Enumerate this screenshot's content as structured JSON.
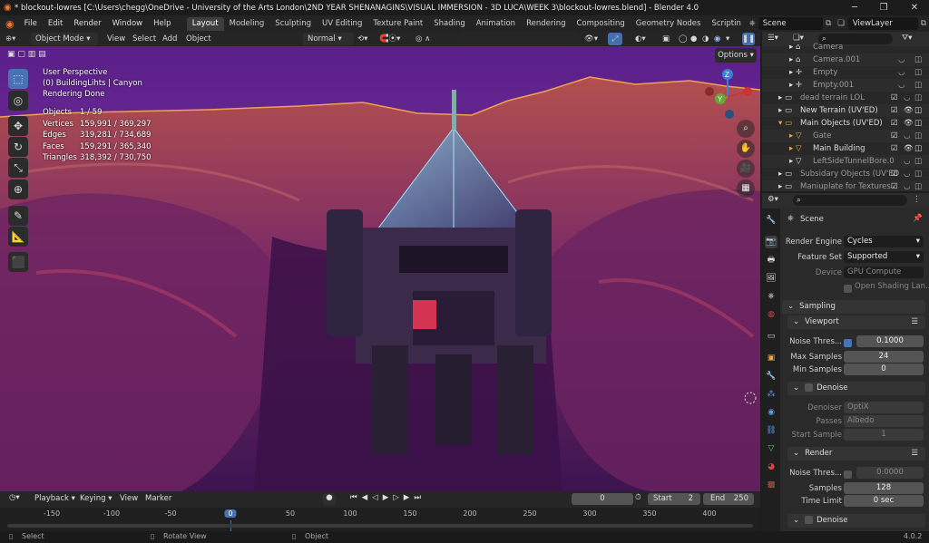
{
  "window": {
    "title": "* blockout-lowres [C:\\Users\\chegg\\OneDrive - University of the Arts London\\2ND YEAR SHENANAGINS\\VISUAL IMMERSION - 3D LUCA\\WEEK 3\\blockout-lowres.blend] - Blender 4.0",
    "minimize": "─",
    "maximize": "❐",
    "close": "✕"
  },
  "menu": [
    "File",
    "Edit",
    "Render",
    "Window",
    "Help"
  ],
  "workspaces": [
    "Layout",
    "Modeling",
    "Sculpting",
    "UV Editing",
    "Texture Paint",
    "Shading",
    "Animation",
    "Rendering",
    "Compositing",
    "Geometry Nodes",
    "Scriptin"
  ],
  "scene": {
    "label": "Scene",
    "viewlayer": "ViewLayer"
  },
  "viewport_header": {
    "mode": "Object Mode",
    "menus": [
      "View",
      "Select",
      "Add",
      "Object"
    ],
    "orientation": "Normal",
    "options": "Options"
  },
  "overlay": {
    "perspective": "User Perspective",
    "collection": "(0) BuildingLihts | Canyon",
    "status": "Rendering Done",
    "stats": [
      {
        "label": "Objects",
        "value": "1 / 59"
      },
      {
        "label": "Vertices",
        "value": "159,991 / 369,297"
      },
      {
        "label": "Edges",
        "value": "319,281 / 734,689"
      },
      {
        "label": "Faces",
        "value": "159,291 / 365,340"
      },
      {
        "label": "Triangles",
        "value": "318,392 / 730,750"
      }
    ]
  },
  "gizmo": {
    "z": "Z",
    "y": "Y"
  },
  "timeline": {
    "menus": [
      "Playback",
      "Keying",
      "View",
      "Marker"
    ],
    "current_frame": "0",
    "start_label": "Start",
    "start": "2",
    "end_label": "End",
    "end": "250",
    "ruler": [
      "-150",
      "-100",
      "-50",
      "0",
      "50",
      "100",
      "150",
      "200",
      "250",
      "300",
      "350",
      "400"
    ]
  },
  "statusbar": {
    "select": "Select",
    "rotate": "Rotate View",
    "object": "Object",
    "version": "4.0.2"
  },
  "outliner": {
    "rows": [
      {
        "label": "Camera",
        "dim": true
      },
      {
        "label": "Camera.001",
        "dim": true
      },
      {
        "label": "Empty",
        "dim": true
      },
      {
        "label": "Empty.001",
        "dim": true
      },
      {
        "label": "dead terrain LOL",
        "dim": true
      },
      {
        "label": "New Terrain (UV'ED)",
        "dim": false
      },
      {
        "label": "Main Objects (UV'ED)",
        "dim": false
      },
      {
        "label": "Gate",
        "dim": true
      },
      {
        "label": "Main Building",
        "dim": false
      },
      {
        "label": "LeftSideTunnelBore.0",
        "dim": true
      },
      {
        "label": "Subsidary Objects (UV'ED",
        "dim": true
      },
      {
        "label": "Maniuplate for Textures",
        "dim": true
      }
    ]
  },
  "properties": {
    "title": "Scene",
    "render_engine_label": "Render Engine",
    "render_engine": "Cycles",
    "feature_set_label": "Feature Set",
    "feature_set": "Supported",
    "device_label": "Device",
    "device": "GPU Compute",
    "open_shading": "Open Shading Lan...",
    "sampling": "Sampling",
    "viewport": "Viewport",
    "noise_threshold_label": "Noise Thres...",
    "viewport_noise": "0.1000",
    "max_samples_label": "Max Samples",
    "max_samples": "24",
    "min_samples_label": "Min Samples",
    "min_samples": "0",
    "denoise": "Denoise",
    "denoiser_label": "Denoiser",
    "denoiser": "OptiX",
    "passes_label": "Passes",
    "passes": "Albedo",
    "start_sample_label": "Start Sample",
    "start_sample": "1",
    "render": "Render",
    "render_noise": "0.0000",
    "samples_label": "Samples",
    "samples": "128",
    "time_limit_label": "Time Limit",
    "time_limit": "0 sec",
    "denoise2": "Denoise"
  }
}
